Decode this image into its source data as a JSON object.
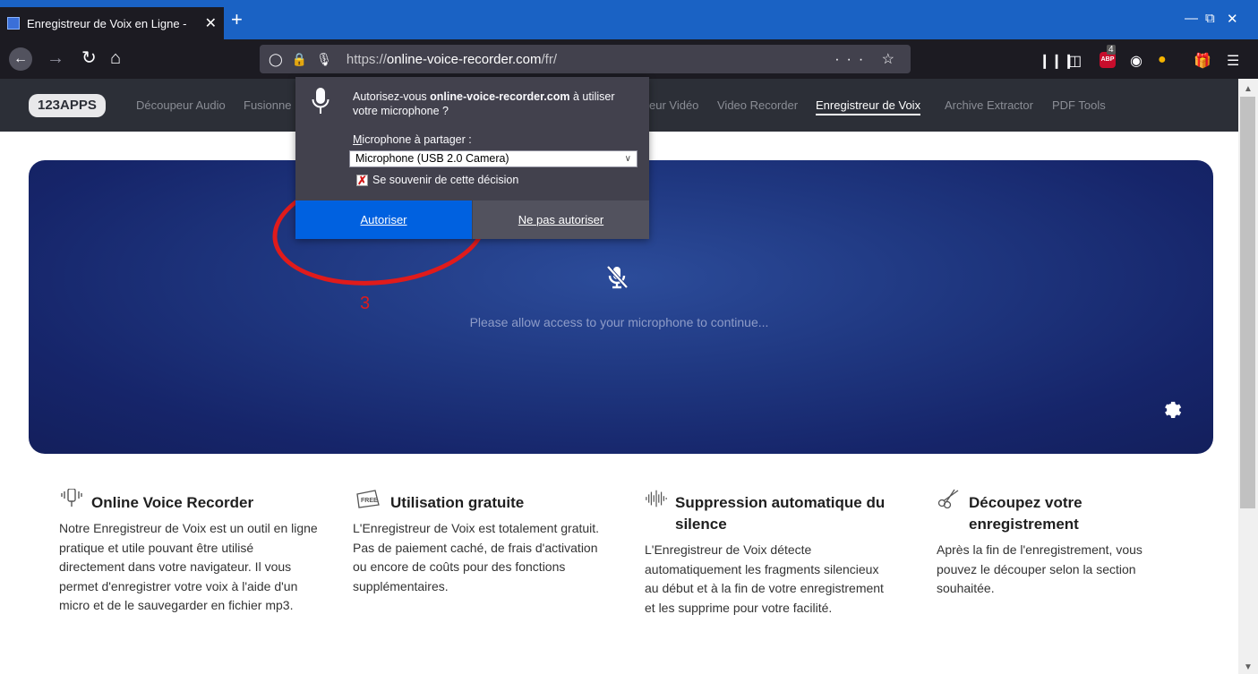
{
  "browser": {
    "tab_title": "Enregistreur de Voix en Ligne -",
    "tab_close": "✕",
    "new_tab": "+",
    "url_prefix": "https://",
    "url_domain": "online-voice-recorder.com",
    "url_path": "/fr/",
    "url_actions": "··· ☆",
    "abp_badge": "4"
  },
  "site_nav": {
    "logo": "123APPS",
    "links": [
      "Découpeur Audio",
      "Fusionne",
      "eur Vidéo",
      "Video Recorder",
      "Enregistreur de Voix",
      "Archive Extractor",
      "PDF Tools"
    ]
  },
  "popup": {
    "question_prefix": "Autorisez-vous ",
    "question_domain": "online-voice-recorder.com",
    "question_suffix": " à utiliser votre microphone ?",
    "mic_label_u": "M",
    "mic_label_rest": "icrophone à partager :",
    "selected_mic": "Microphone (USB 2.0 Camera)",
    "remember": "Se souvenir de cette décision",
    "allow": "Autoriser",
    "deny": "Ne pas autoriser"
  },
  "recorder": {
    "allow_message": "Please allow access to your microphone to continue...",
    "annotation": "3"
  },
  "features": [
    {
      "title": "Online Voice Recorder",
      "text": "Notre Enregistreur de Voix est un outil en ligne pratique et utile pouvant être utilisé directement dans votre navigateur. Il vous permet d'enregistrer votre voix à l'aide d'un micro et de le sauvegarder en fichier mp3."
    },
    {
      "title": "Utilisation gratuite",
      "text": "L'Enregistreur de Voix est totalement gratuit. Pas de paiement caché, de frais d'activation ou encore de coûts pour des fonctions supplémentaires."
    },
    {
      "title": "Suppression automatique du silence",
      "text": "L'Enregistreur de Voix détecte automatiquement les fragments silencieux au début et à la fin de votre enregistrement et les supprime pour votre facilité."
    },
    {
      "title": "Découpez votre enregistrement",
      "text": "Après la fin de l'enregistrement, vous pouvez le découper selon la section souhaitée."
    }
  ],
  "colors": {
    "accent_blue": "#0061e0",
    "annotation_red": "#e01b1b",
    "panel_blue": "#1f3780"
  }
}
